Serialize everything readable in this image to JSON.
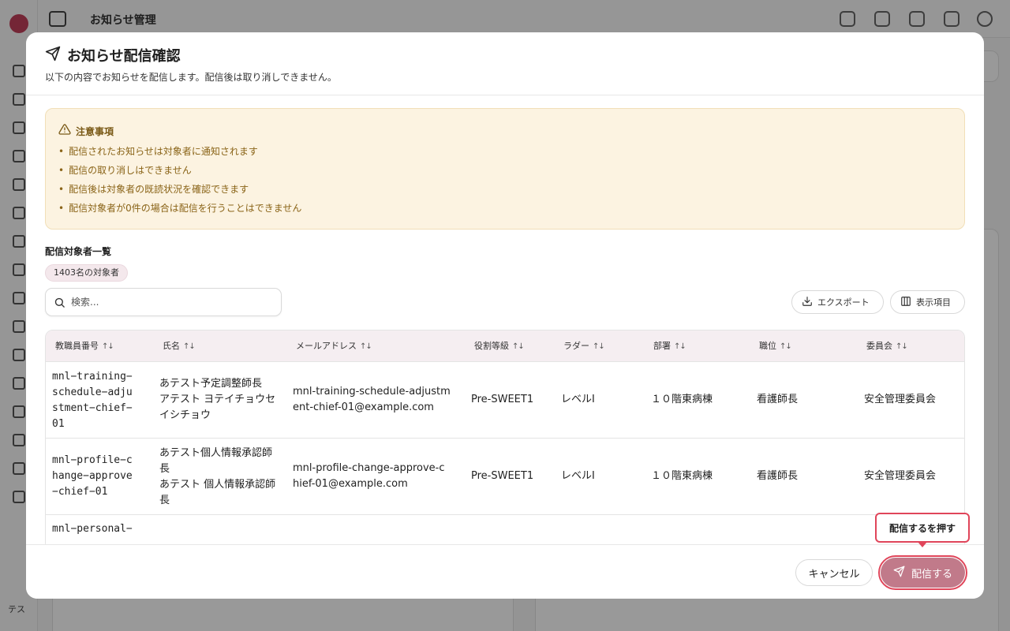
{
  "app": {
    "page_title": "お知らせ管理",
    "user_initials": "テス"
  },
  "modal": {
    "title": "お知らせ配信確認",
    "description": "以下の内容でお知らせを配信します。配信後は取り消しできません。",
    "notice": {
      "title": "注意事項",
      "items": [
        "配信されたお知らせは対象者に通知されます",
        "配信の取り消しはできません",
        "配信後は対象者の既読状況を確認できます",
        "配信対象者が0件の場合は配信を行うことはできません"
      ]
    },
    "recipients": {
      "title": "配信対象者一覧",
      "count_label": "1403名の対象者",
      "search_placeholder": "検索...",
      "export_label": "エクスポート",
      "columns_label": "表示項目",
      "columns": [
        "教職員番号",
        "氏名",
        "メールアドレス",
        "役割等級",
        "ラダー",
        "部署",
        "職位",
        "委員会"
      ],
      "rows": [
        {
          "id": "mnl-training-schedule-adjustment-chief-01",
          "id_lines": [
            "mnl−training−",
            "schedule−adju",
            "stment−chief−",
            "01"
          ],
          "name_lines": [
            "あテスト予定調整師長",
            "アテスト ヨテイチョウセ",
            "イシチョウ"
          ],
          "email_lines": [
            "mnl-training-schedule-adjustm",
            "ent-chief-01@example.com"
          ],
          "grade": "Pre-SWEET1",
          "ladder": "レベルI",
          "department": "１０階東病棟",
          "position": "看護師長",
          "committee": "安全管理委員会"
        },
        {
          "id": "mnl-profile-change-approve-chief-01",
          "id_lines": [
            "mnl−profile−c",
            "hange−approve",
            "−chief−01"
          ],
          "name_lines": [
            "あテスト個人情報承認師",
            "長",
            "あテスト 個人情報承認師",
            "長"
          ],
          "email_lines": [
            "mnl-profile-change-approve-c",
            "hief-01@example.com"
          ],
          "grade": "Pre-SWEET1",
          "ladder": "レベルI",
          "department": "１０階東病棟",
          "position": "看護師長",
          "committee": "安全管理委員会"
        },
        {
          "id_partial": "mnl−personal−"
        }
      ]
    },
    "footer": {
      "cancel_label": "キャンセル",
      "send_label": "配信する"
    }
  },
  "tooltip": {
    "text": "配信するを押す"
  },
  "colors": {
    "accent": "#c17a8a",
    "highlight": "#e0455a",
    "notice_bg": "#fcf3e1",
    "notice_text": "#8a6418"
  }
}
